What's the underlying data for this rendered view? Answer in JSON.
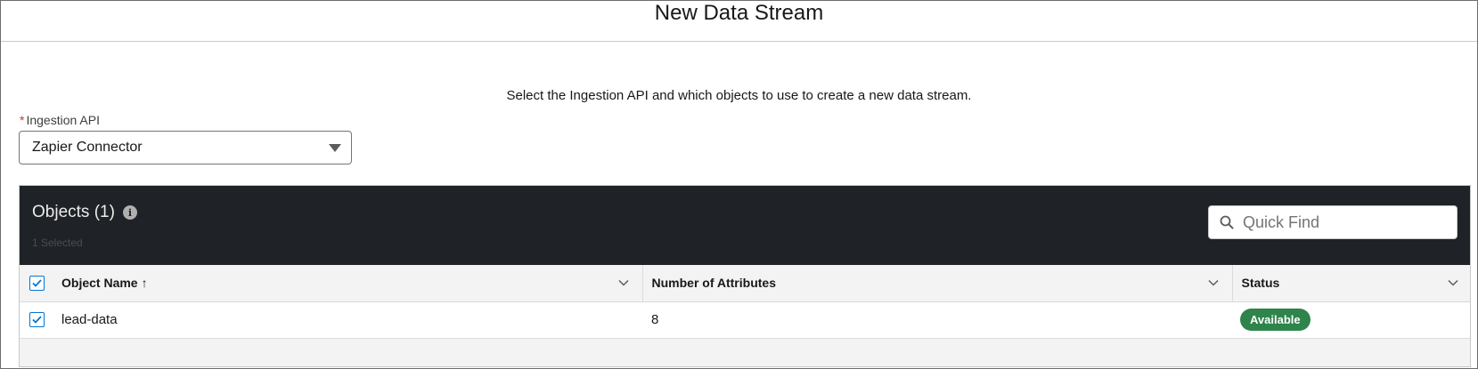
{
  "modal": {
    "title": "New Data Stream"
  },
  "instructions": "Select the Ingestion API and which objects to use to create a new data stream.",
  "ingestion_api": {
    "required_mark": "*",
    "label": "Ingestion API",
    "selected": "Zapier Connector"
  },
  "objects": {
    "title": "Objects (1)",
    "subtitle": "1 Selected",
    "search_placeholder": "Quick Find",
    "columns": {
      "object_name": "Object Name",
      "sort_indicator": "↑",
      "attributes": "Number of Attributes",
      "status": "Status"
    },
    "rows": [
      {
        "name": "lead-data",
        "attributes": "8",
        "status": "Available",
        "checked": true
      }
    ]
  },
  "colors": {
    "header_dark": "#1f2227",
    "brand_blue": "#0176d3",
    "status_green": "#2e844a"
  }
}
